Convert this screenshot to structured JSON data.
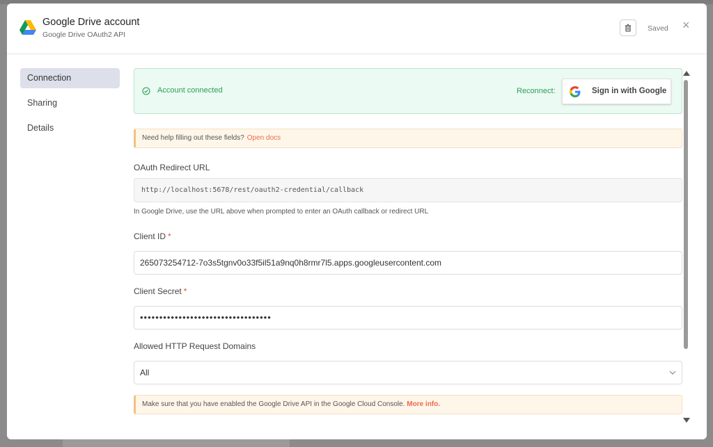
{
  "header": {
    "title": "Google Drive account",
    "subtitle": "Google Drive OAuth2 API",
    "saved_label": "Saved",
    "close_glyph": "×",
    "delete_icon": "trash-icon",
    "logo_icon": "google-drive-logo"
  },
  "sidebar": {
    "items": [
      {
        "label": "Connection",
        "active": true
      },
      {
        "label": "Sharing",
        "active": false
      },
      {
        "label": "Details",
        "active": false
      }
    ]
  },
  "connection": {
    "status_text": "Account connected",
    "reconnect_label": "Reconnect:",
    "google_button_label": "Sign in with Google",
    "help_text": "Need help filling out these fields?",
    "help_link": "Open docs",
    "redirect_label": "OAuth Redirect URL",
    "redirect_url": "http://localhost:5678/rest/oauth2-credential/callback",
    "redirect_hint": "In Google Drive, use the URL above when prompted to enter an OAuth callback or redirect URL",
    "client_id_label": "Client ID",
    "client_id_value": "265073254712-7o3s5tgnv0o33f5il51a9nq0h8rmr7l5.apps.googleusercontent.com",
    "client_secret_label": "Client Secret",
    "client_secret_value": "••••••••••••••••••••••••••••••••••",
    "required_mark": "*",
    "domains_label": "Allowed HTTP Request Domains",
    "domains_value": "All",
    "api_note_text": "Make sure that you have enabled the Google Drive API in the Google Cloud Console.",
    "api_note_link": "More info."
  },
  "colors": {
    "success": "#2a9d5b",
    "link": "#ec6a4c",
    "required": "#e5533d",
    "active_nav": "#dde0ea"
  }
}
